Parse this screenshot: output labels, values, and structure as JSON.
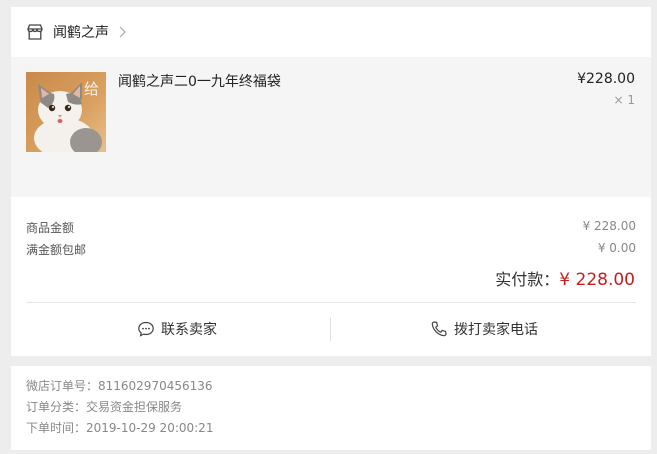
{
  "shop": {
    "name": "闻鹤之声"
  },
  "product": {
    "title": "闻鹤之声二0一九年终福袋",
    "price": "¥228.00",
    "quantity": "× 1",
    "thumb_overlay_text": "给"
  },
  "summary": {
    "goods_label": "商品金额",
    "goods_value": "¥ 228.00",
    "shipping_label": "满金额包邮",
    "shipping_value": "¥ 0.00",
    "total_label": "实付款：",
    "total_value": "¥ 228.00"
  },
  "actions": {
    "contact_label": "联系卖家",
    "call_label": "拨打卖家电话"
  },
  "order_info": {
    "order_no": "微店订单号：811602970456136",
    "category": "订单分类：交易资金担保服务",
    "time": "下单时间：2019-10-29 20:00:21"
  },
  "colors": {
    "accent_red": "#c81e1e",
    "background": "#ededed",
    "product_bg": "#f5f5f5"
  },
  "icons": {
    "shop": "store-icon",
    "chevron": "chevron-right-icon",
    "contact": "chat-bubble-icon",
    "call": "phone-icon"
  }
}
